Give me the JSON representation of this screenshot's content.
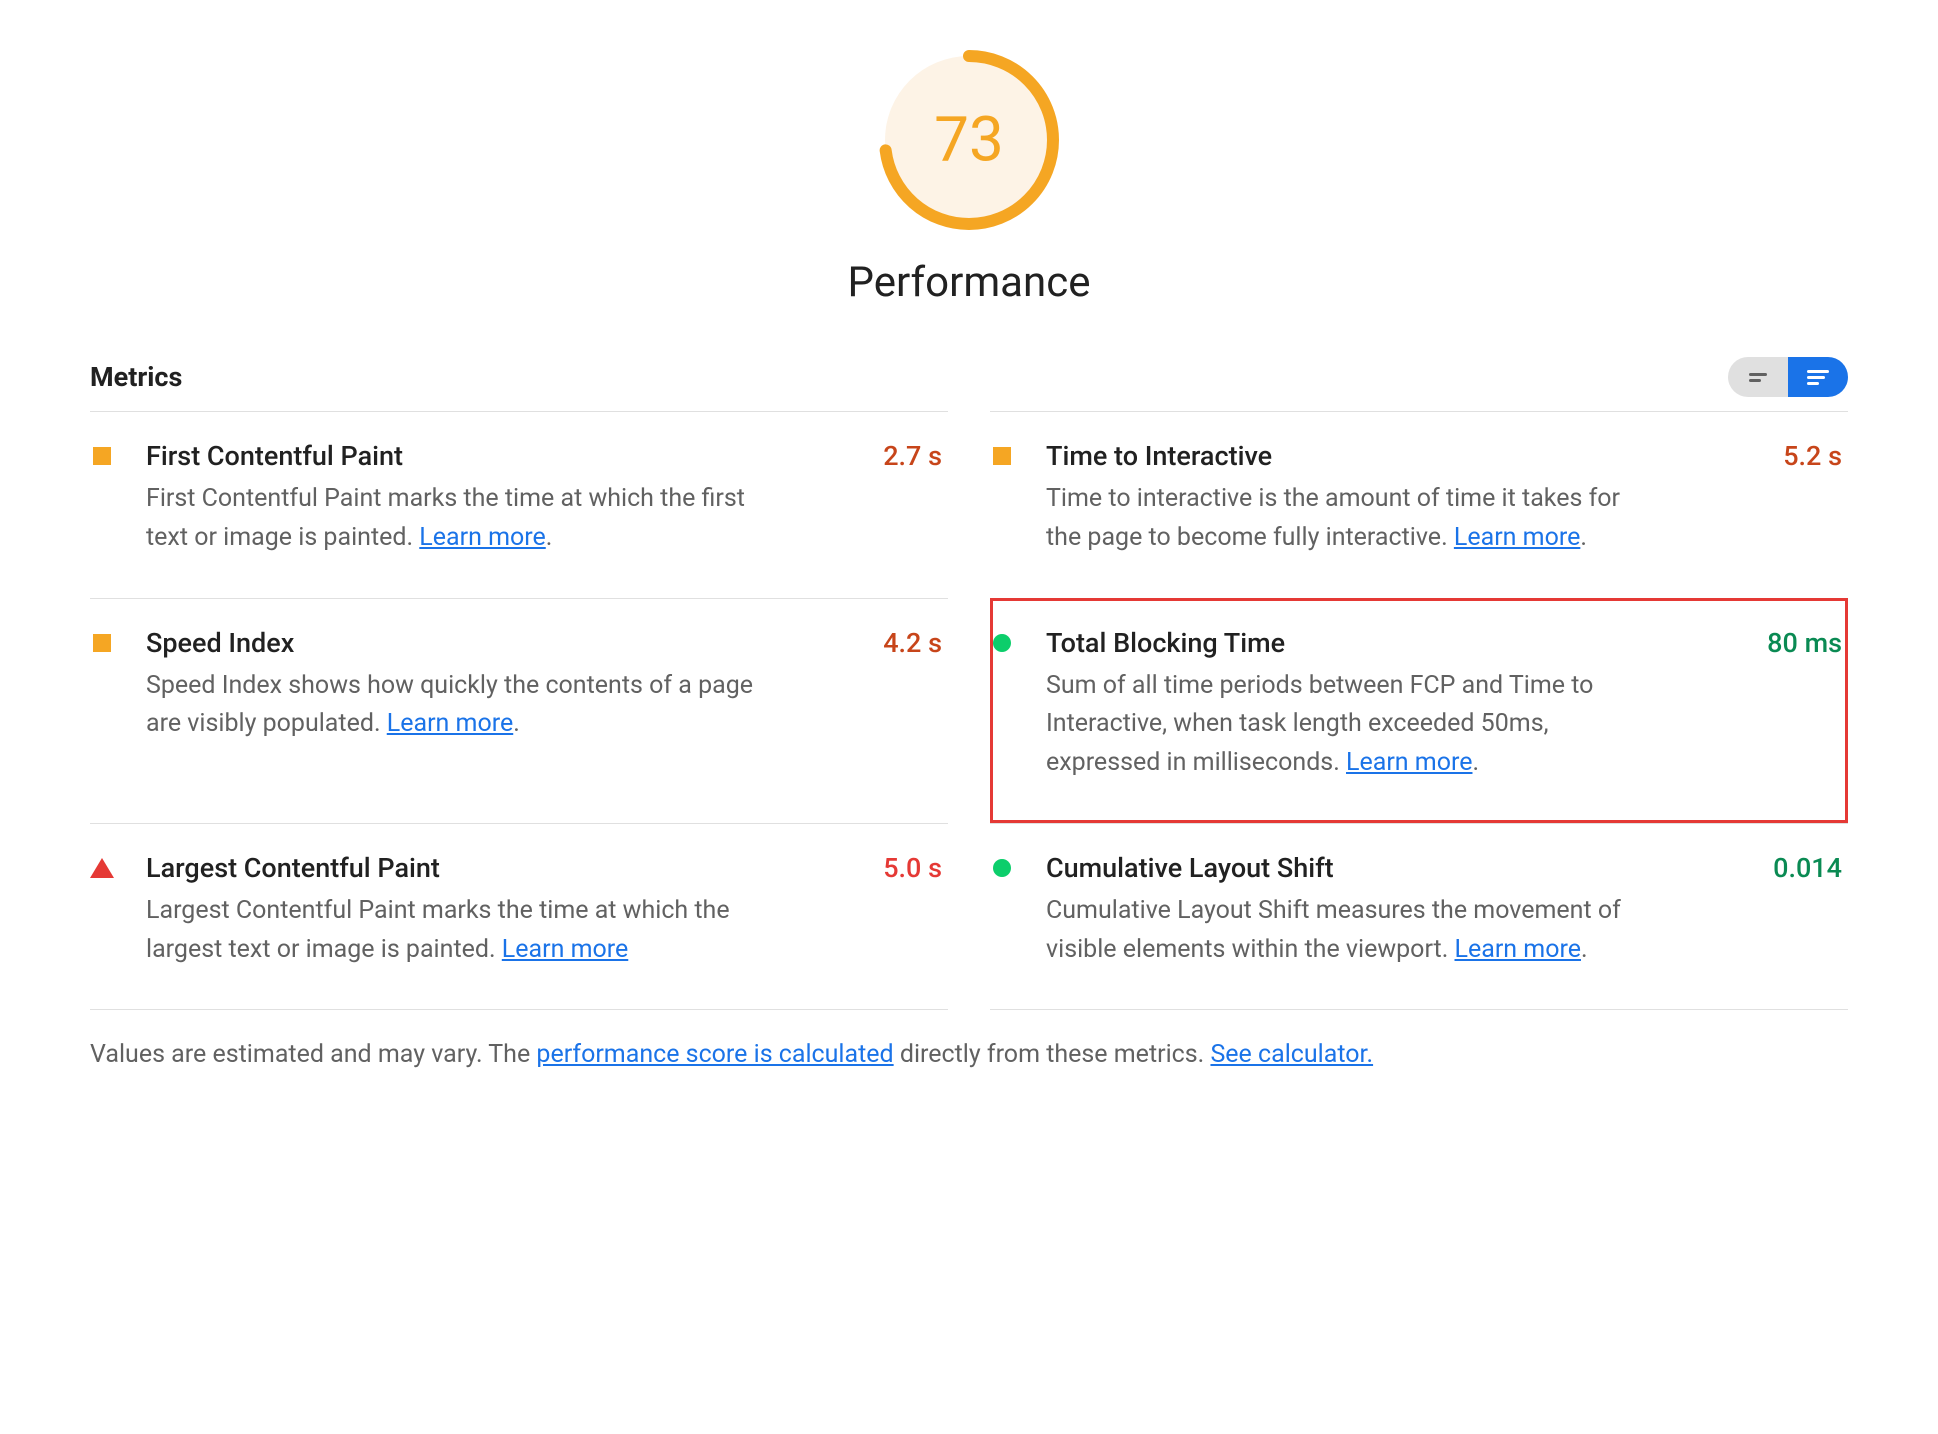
{
  "score": "73",
  "category_title": "Performance",
  "metrics_heading": "Metrics",
  "learn_more": "Learn more",
  "metrics": {
    "fcp": {
      "title": "First Contentful Paint",
      "desc": "First Contentful Paint marks the time at which the first text or image is painted.",
      "value": "2.7 s"
    },
    "tti": {
      "title": "Time to Interactive",
      "desc_pre": "Time to interactive is the amount of time it takes for the page to become fully interactive.",
      "value": "5.2 s"
    },
    "si": {
      "title": "Speed Index",
      "desc": "Speed Index shows how quickly the contents of a page are visibly populated.",
      "value": "4.2 s"
    },
    "tbt": {
      "title": "Total Blocking Time",
      "desc": "Sum of all time periods between FCP and Time to Interactive, when task length exceeded 50ms, expressed in milliseconds.",
      "value": "80 ms"
    },
    "lcp": {
      "title": "Largest Contentful Paint",
      "desc": "Largest Contentful Paint marks the time at which the largest text or image is painted.",
      "value": "5.0 s"
    },
    "cls": {
      "title": "Cumulative Layout Shift",
      "desc_pre": "Cumulative Layout Shift measures the movement of visible elements within the viewport.",
      "value": "0.014"
    }
  },
  "footnote": {
    "pre": "Values are estimated and may vary. The ",
    "link1": "performance score is calculated",
    "mid": " directly from these metrics. ",
    "link2": "See calculator."
  }
}
